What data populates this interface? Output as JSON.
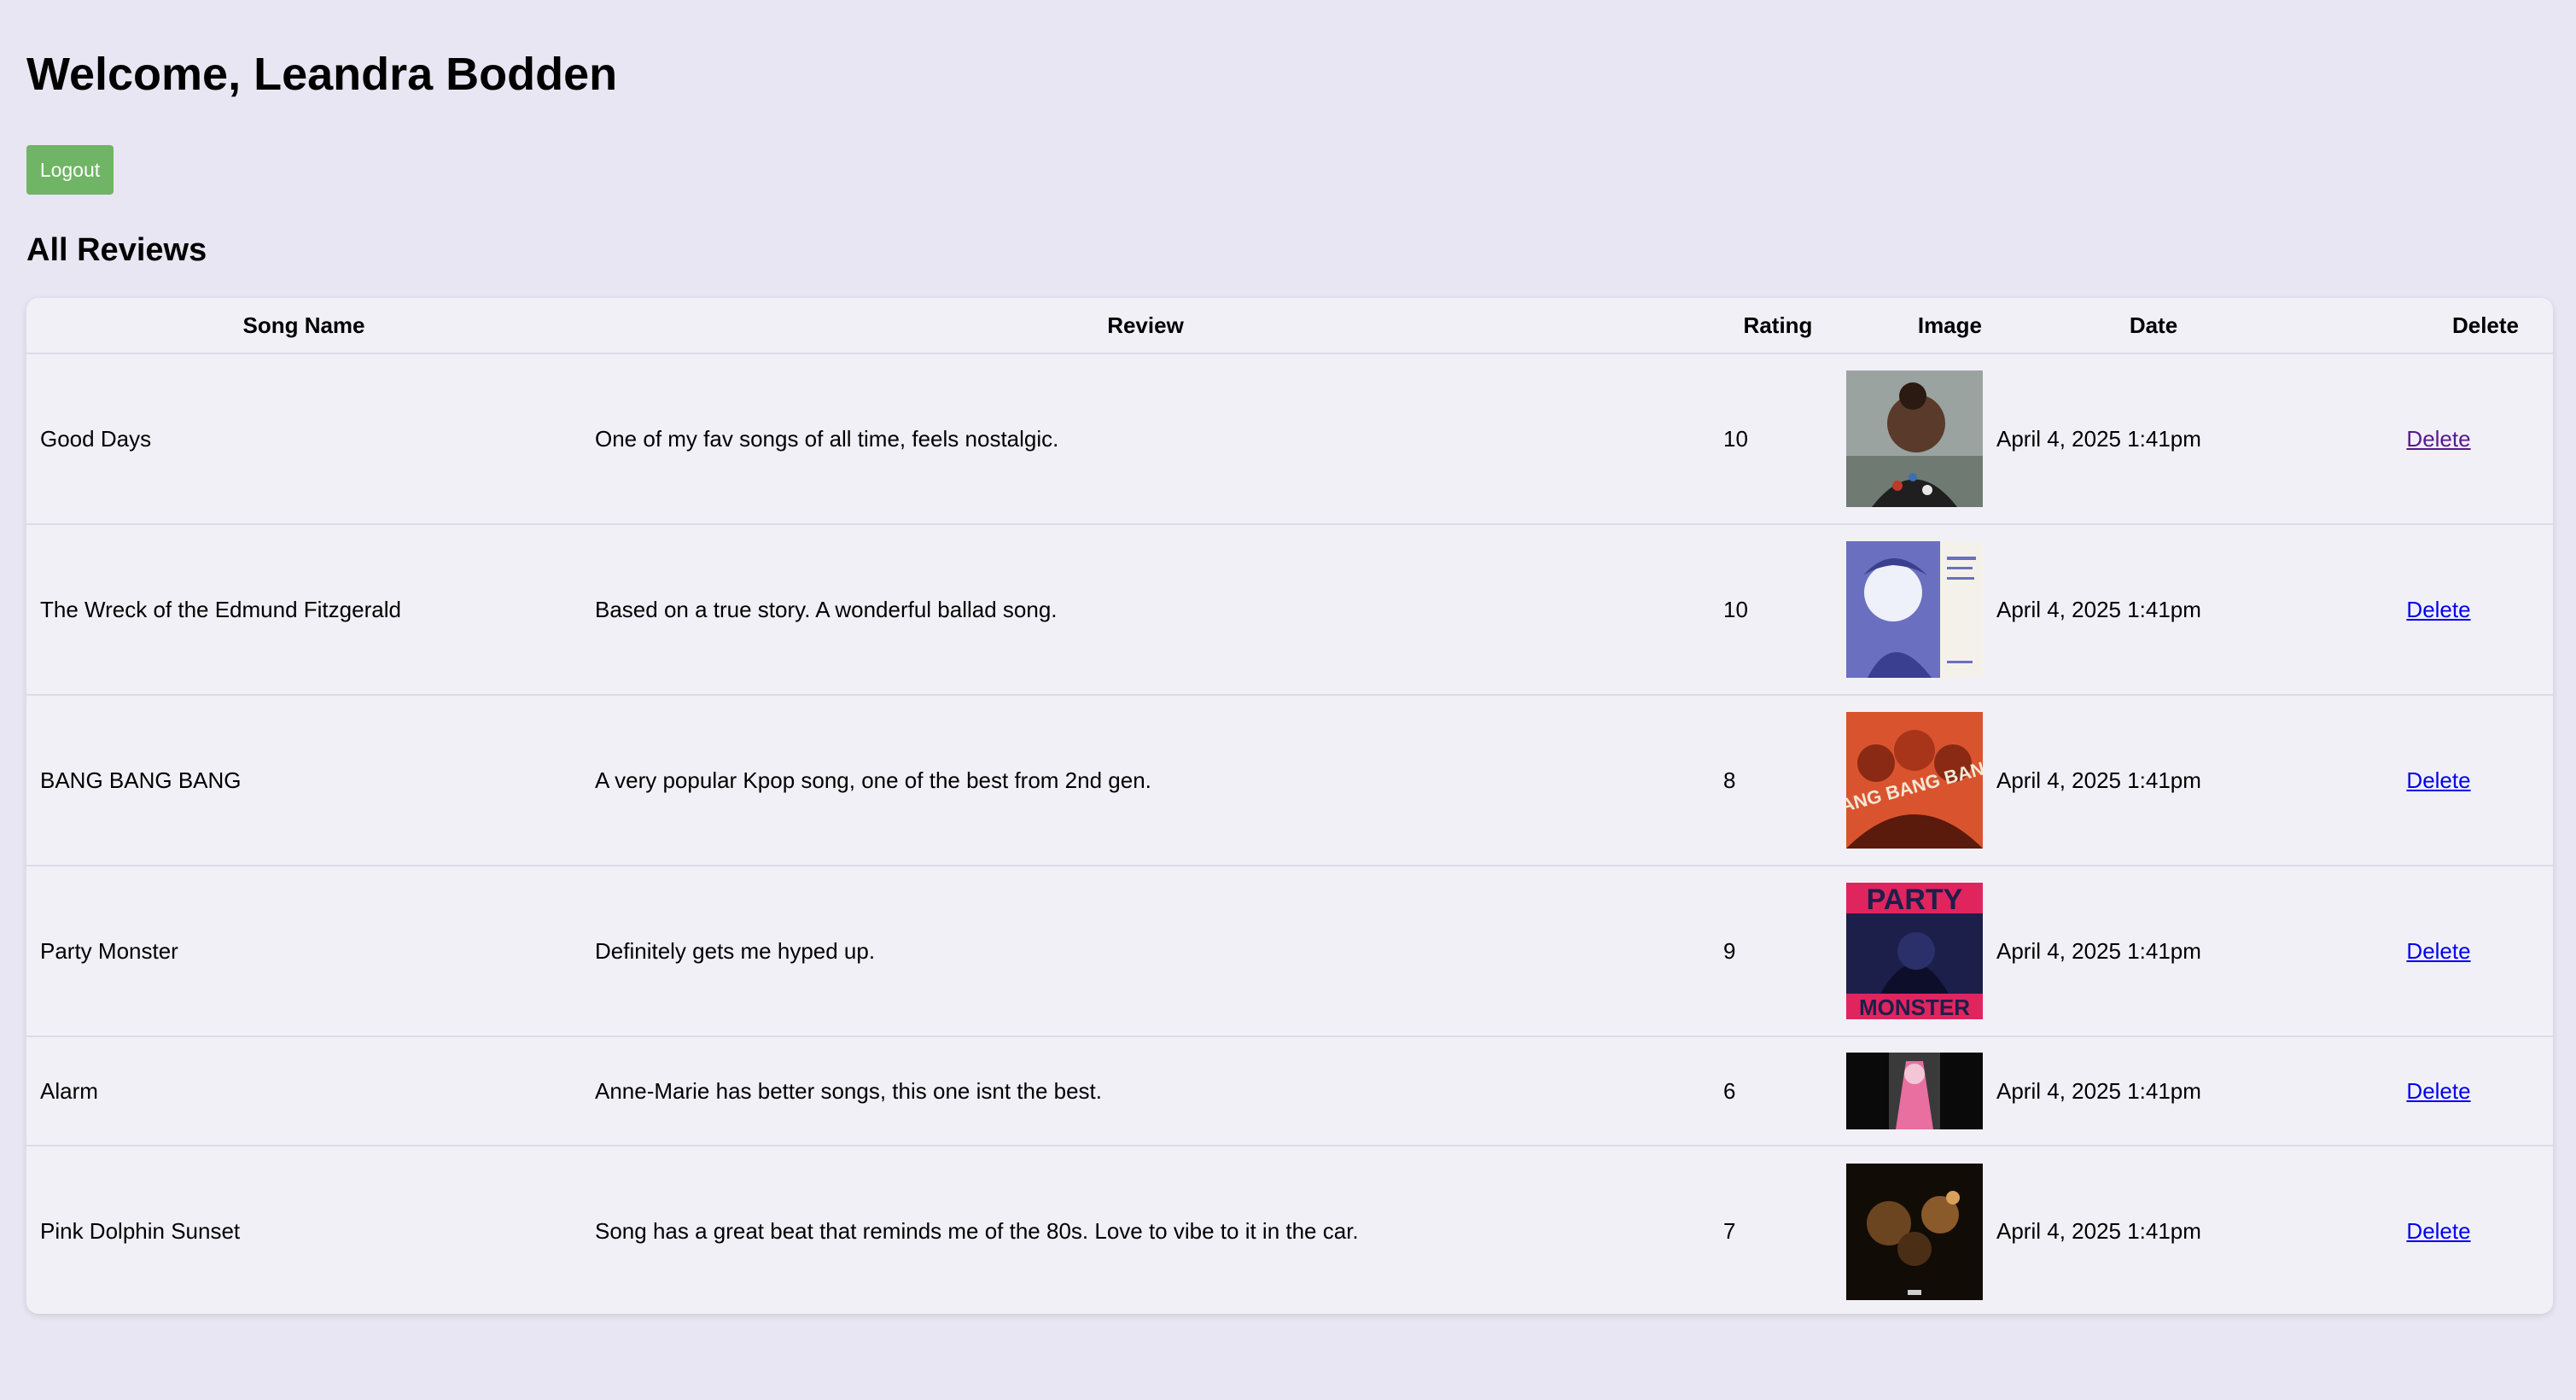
{
  "header": {
    "welcome": "Welcome, Leandra Bodden",
    "logout_label": "Logout"
  },
  "section_title": "All Reviews",
  "table": {
    "headers": [
      "Song Name",
      "Review",
      "Rating",
      "Image",
      "Date",
      "Delete"
    ],
    "rows": [
      {
        "song": "Good Days",
        "review": "One of my fav songs of all time, feels nostalgic.",
        "rating": "10",
        "date": "April 4, 2025 1:41pm",
        "delete": "Delete"
      },
      {
        "song": "The Wreck of the Edmund Fitzgerald",
        "review": "Based on a true story. A wonderful ballad song.",
        "rating": "10",
        "date": "April 4, 2025 1:41pm",
        "delete": "Delete"
      },
      {
        "song": "BANG BANG BANG",
        "review": "A very popular Kpop song, one of the best from 2nd gen.",
        "rating": "8",
        "date": "April 4, 2025 1:41pm",
        "delete": "Delete"
      },
      {
        "song": "Party Monster",
        "review": "Definitely gets me hyped up.",
        "rating": "9",
        "date": "April 4, 2025 1:41pm",
        "delete": "Delete"
      },
      {
        "song": "Alarm",
        "review": "Anne-Marie has better songs, this one isnt the best.",
        "rating": "6",
        "date": "April 4, 2025 1:41pm",
        "delete": "Delete"
      },
      {
        "song": "Pink Dolphin Sunset",
        "review": "Song has a great beat that reminds me of the 80s. Love to vibe to it in the car.",
        "rating": "7",
        "date": "April 4, 2025 1:41pm",
        "delete": "Delete"
      }
    ]
  },
  "album_art": {
    "party_monster_top": "PARTY",
    "party_monster_bottom": "MONSTER",
    "bang_text": "BANG BANG BANG"
  },
  "colors": {
    "background": "#e8e6f2",
    "card": "#f2f0f7",
    "logout_button": "#70b466",
    "link": "#0000ee",
    "visited_link": "#551a8b"
  }
}
